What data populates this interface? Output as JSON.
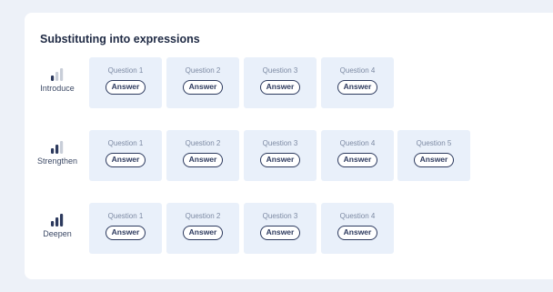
{
  "section_title": "Substituting into expressions",
  "answer_label": "Answer",
  "rows": [
    {
      "level": "Introduce",
      "strength": 1,
      "questions": [
        "Question 1",
        "Question 2",
        "Question 3",
        "Question 4"
      ]
    },
    {
      "level": "Strengthen",
      "strength": 2,
      "questions": [
        "Question 1",
        "Question 2",
        "Question 3",
        "Question 4",
        "Question 5"
      ]
    },
    {
      "level": "Deepen",
      "strength": 3,
      "questions": [
        "Question 1",
        "Question 2",
        "Question 3",
        "Question 4"
      ]
    }
  ],
  "colors": {
    "bar_on": "#2d3a5e",
    "bar_off": "#c8ced8",
    "tile_bg": "#e9f0fa"
  }
}
